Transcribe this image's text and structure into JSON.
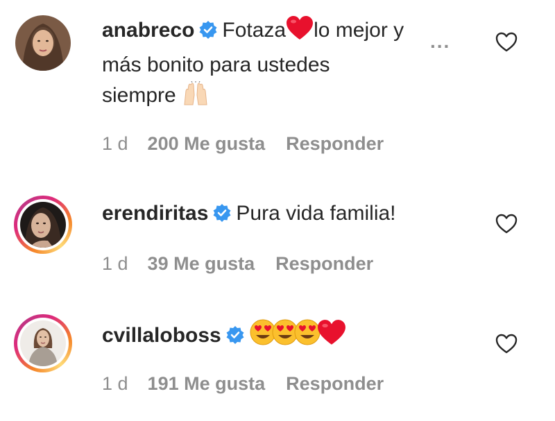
{
  "comments": [
    {
      "username": "anabreco",
      "text_part1": "Fotaza",
      "text_part2": "lo mejor y",
      "text_line2": "más bonito para ustedes",
      "text_line3": "siempre",
      "more": "...",
      "time": "1 d",
      "likes": "200 Me gusta",
      "reply": "Responder",
      "avatar_ring": false
    },
    {
      "username": "erendiritas",
      "text": "Pura vida familia!",
      "time": "1 d",
      "likes": "39 Me gusta",
      "reply": "Responder",
      "avatar_ring": true
    },
    {
      "username": "cvillaloboss",
      "text": "",
      "time": "1 d",
      "likes": "191 Me gusta",
      "reply": "Responder",
      "avatar_ring": true
    }
  ],
  "colors": {
    "verified_blue": "#3897f0",
    "meta_gray": "#8e8e8e",
    "text": "#262626",
    "heart_red": "#e8112d"
  }
}
